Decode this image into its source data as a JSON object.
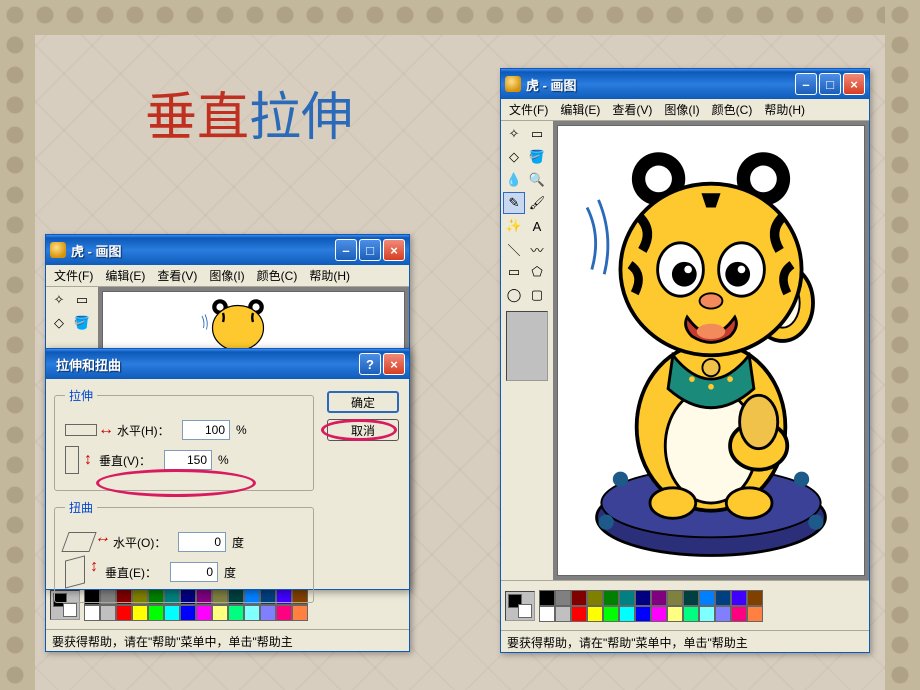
{
  "slide": {
    "title_part1": "垂直",
    "title_part2": "拉伸"
  },
  "paint_window": {
    "title": "虎 - 画图",
    "menus": [
      "文件(F)",
      "编辑(E)",
      "查看(V)",
      "图像(I)",
      "颜色(C)",
      "帮助(H)"
    ],
    "tools": [
      "free-select-icon",
      "rect-select-icon",
      "eraser-icon",
      "fill-icon",
      "picker-icon",
      "magnifier-icon",
      "pencil-icon",
      "brush-icon",
      "airbrush-icon",
      "text-icon",
      "line-icon",
      "curve-icon",
      "rect-icon",
      "polygon-icon",
      "ellipse-icon",
      "roundrect-icon"
    ],
    "tool_glyphs": [
      "✧",
      "▭",
      "◇",
      "🪣",
      "💧",
      "🔍",
      "✎",
      "🖌",
      "✨",
      "A",
      "＼",
      "〰",
      "▭",
      "⬠",
      "◯",
      "▢"
    ],
    "palette_colors": [
      "#000000",
      "#808080",
      "#800000",
      "#808000",
      "#008000",
      "#008080",
      "#000080",
      "#800080",
      "#808040",
      "#004040",
      "#0080ff",
      "#004080",
      "#4000ff",
      "#804000",
      "#ffffff",
      "#c0c0c0",
      "#ff0000",
      "#ffff00",
      "#00ff00",
      "#00ffff",
      "#0000ff",
      "#ff00ff",
      "#ffff80",
      "#00ff80",
      "#80ffff",
      "#8080ff",
      "#ff0080",
      "#ff8040"
    ],
    "status_text": "要获得帮助，请在\"帮助\"菜单中，单击\"帮助主"
  },
  "dialog": {
    "title": "拉伸和扭曲",
    "group1_legend": "拉伸",
    "group2_legend": "扭曲",
    "horizontal_label": "水平(H)：",
    "vertical_label": "垂直(V)：",
    "horizontal_value": "100",
    "vertical_value": "150",
    "skew_h_label": "水平(O)：",
    "skew_v_label": "垂直(E)：",
    "skew_h_value": "0",
    "skew_v_value": "0",
    "percent_unit": "%",
    "degree_unit": "度",
    "ok_label": "确定",
    "cancel_label": "取消"
  },
  "window_controls": {
    "minimize": "–",
    "maximize": "□",
    "close": "×",
    "help": "?"
  }
}
